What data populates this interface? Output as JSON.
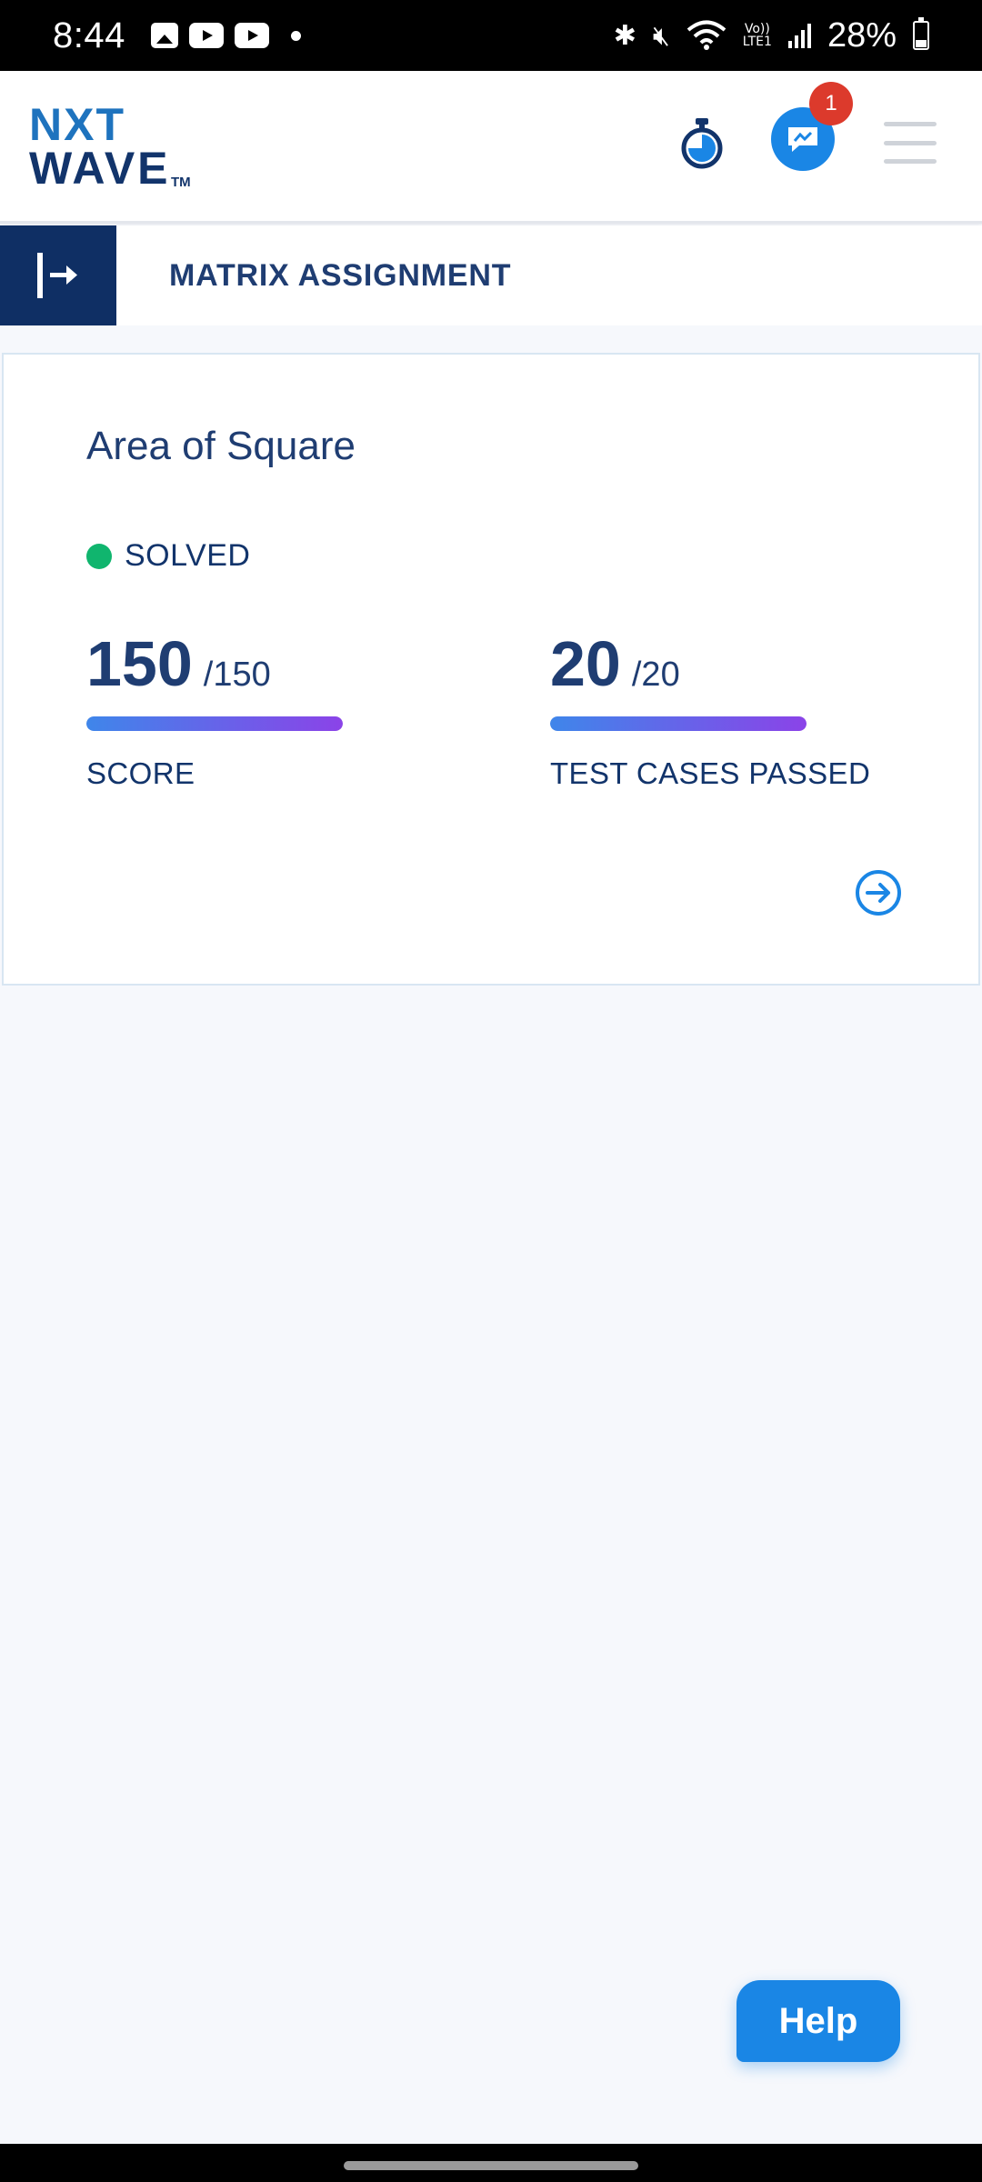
{
  "status_bar": {
    "time": "8:44",
    "battery": "28%",
    "network_label_top": "Vo))",
    "network_label_bottom": "LTE1"
  },
  "header": {
    "logo_line1": "NXT",
    "logo_line2": "WAVE",
    "logo_tm": "TM",
    "chat_badge_count": "1",
    "icons": [
      "stopwatch-icon",
      "chat-icon",
      "menu-icon"
    ]
  },
  "assignment": {
    "title": "MATRIX ASSIGNMENT"
  },
  "card": {
    "title": "Area of Square",
    "status": "SOLVED",
    "status_color": "#10b56e",
    "score": {
      "value": "150",
      "total": "/150",
      "label": "SCORE",
      "progress_fraction": 1.0
    },
    "tests": {
      "value": "20",
      "total": "/20",
      "label": "TEST CASES PASSED",
      "progress_fraction": 1.0
    }
  },
  "help": {
    "label": "Help"
  },
  "colors": {
    "primary_dark": "#0f2f64",
    "text_navy": "#1f3d72",
    "accent_blue": "#1a86e5",
    "badge_red": "#dc3a2c",
    "progress_start": "#3f86ea",
    "progress_end": "#8b43e8"
  }
}
